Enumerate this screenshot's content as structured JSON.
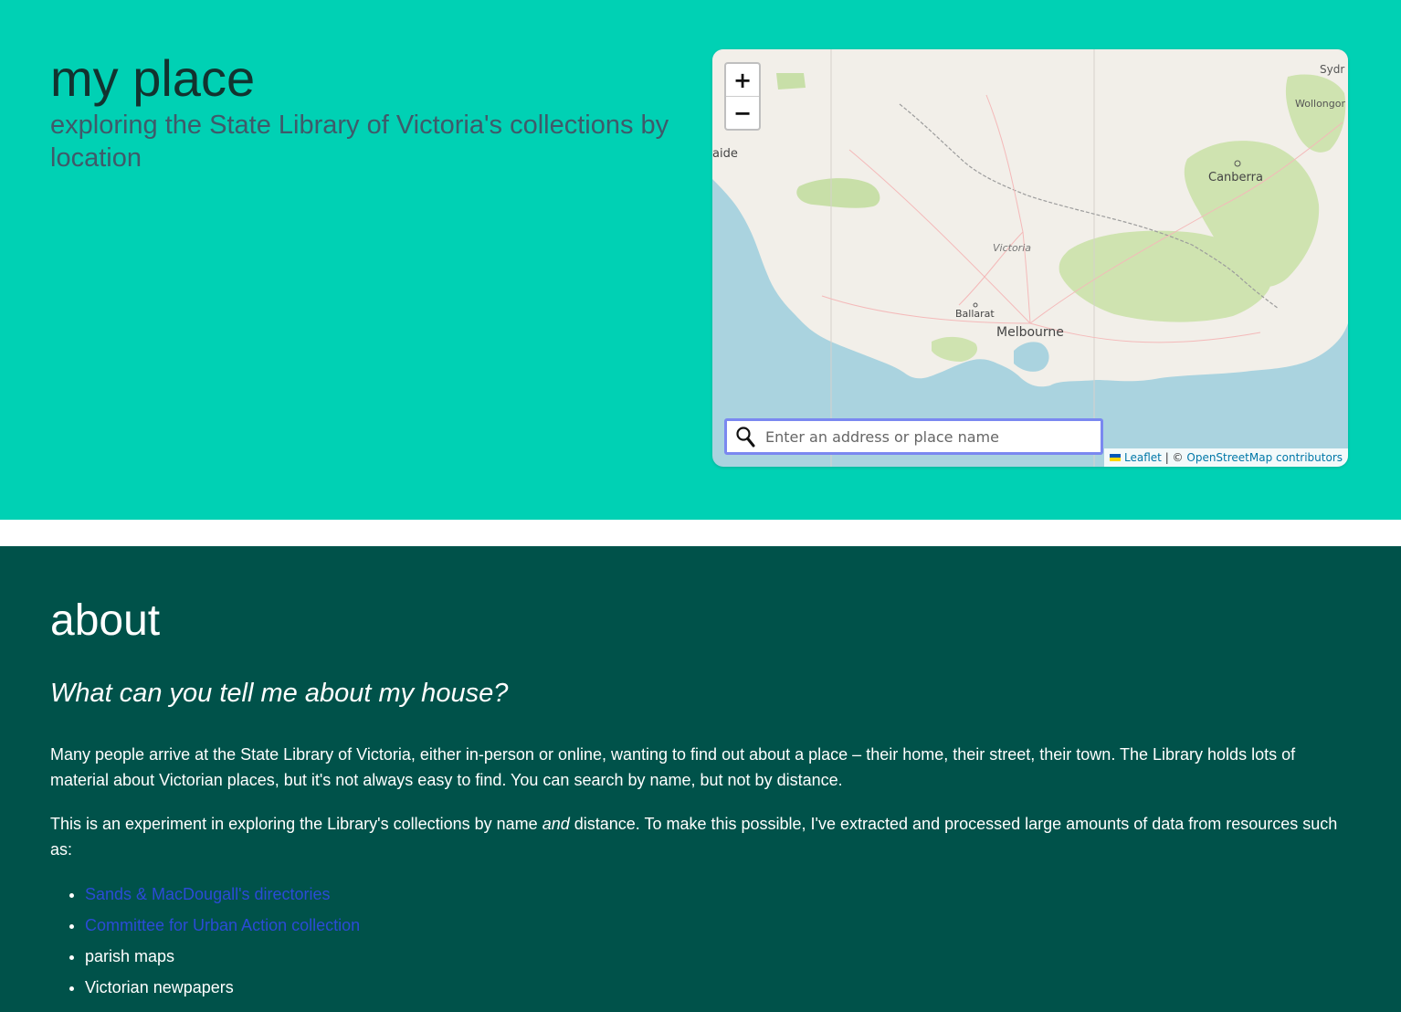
{
  "hero": {
    "title": "my place",
    "subtitle": "exploring the State Library of Victoria's collections by location"
  },
  "map": {
    "zoom_in_label": "+",
    "zoom_out_label": "−",
    "search_placeholder": "Enter an address or place name",
    "search_icon": "magnifier-icon",
    "place_labels": {
      "sydney": "Sydr",
      "wollongong": "Wollongor",
      "adelaide": "aide",
      "canberra": "Canberra",
      "victoria": "Victoria",
      "ballarat": "Ballarat",
      "melbourne": "Melbourne"
    },
    "attribution": {
      "leaflet": "Leaflet",
      "separator": " | © ",
      "osm": "OpenStreetMap contributors"
    },
    "colors": {
      "sea": "#aad3df",
      "land": "#f2efe9",
      "forest": "#c8dfa8"
    }
  },
  "about": {
    "title": "about",
    "question": "What can you tell me about my house?",
    "p1": "Many people arrive at the State Library of Victoria, either in-person or online, wanting to find out about a place – their home, their street, their town. The Library holds lots of material about Victorian places, but it's not always easy to find. You can search by name, but not by distance.",
    "p2": {
      "before": "This is an experiment in exploring the Library's collections by name ",
      "emphasis": "and",
      "after": " distance. To make this possible, I've extracted and processed large amounts of data from resources such as:"
    },
    "resources": [
      {
        "label": "Sands & MacDougall's directories",
        "link": true
      },
      {
        "label": "Committee for Urban Action collection",
        "link": true
      },
      {
        "label": "parish maps",
        "link": false
      },
      {
        "label": "Victorian newpapers",
        "link": false
      }
    ]
  },
  "colors": {
    "hero_bg": "#00d1b4",
    "about_bg": "#00524a",
    "link": "#2b4bd6"
  }
}
